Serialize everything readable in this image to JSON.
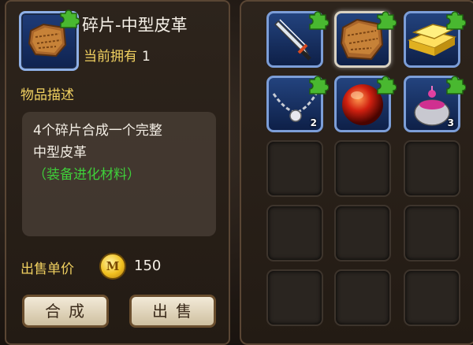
{
  "item": {
    "name": "碎片-中型皮革",
    "owned_label": "当前拥有",
    "owned_count": "1",
    "description_label": "物品描述",
    "description_line1": "4个碎片合成一个完整",
    "description_line2": "中型皮革",
    "description_note": "（装备进化材料）",
    "price_label": "出售单价",
    "coin_letter": "M",
    "price": "150"
  },
  "buttons": {
    "combine": "合成",
    "sell": "出售"
  },
  "inventory": [
    {
      "icon": "dagger-icon",
      "count": ""
    },
    {
      "icon": "leather-icon",
      "count": "",
      "selected": true
    },
    {
      "icon": "gold-bars-icon",
      "count": ""
    },
    {
      "icon": "chain-amulet-icon",
      "count": "2"
    },
    {
      "icon": "red-orb-icon",
      "count": ""
    },
    {
      "icon": "potion-pot-icon",
      "count": "3"
    }
  ],
  "colors": {
    "accent_yellow": "#f0d060",
    "note_green": "#3fcf3a",
    "slot_blue": "#23437e",
    "puzzle_green": "#49b830"
  }
}
